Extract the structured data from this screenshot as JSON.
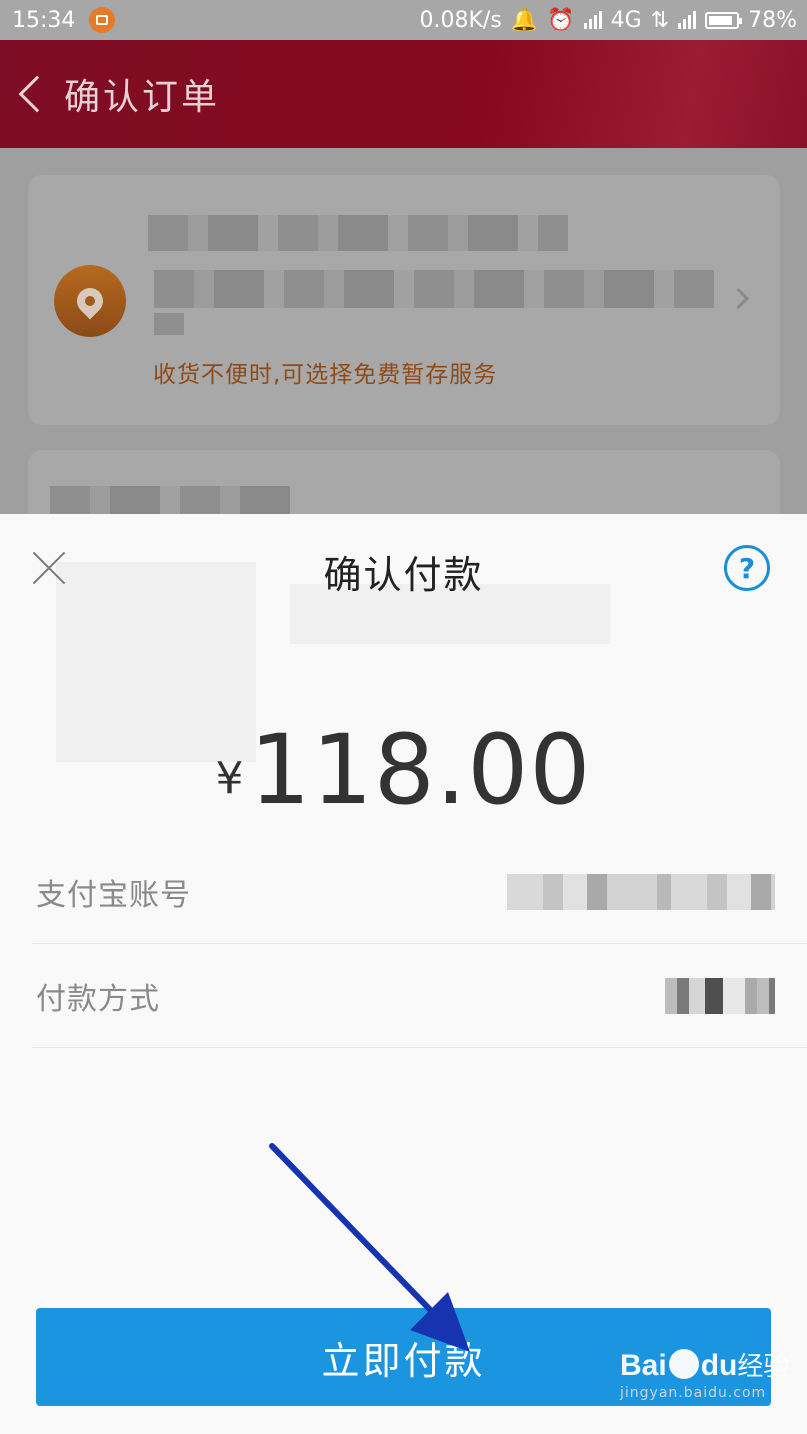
{
  "status_bar": {
    "time": "15:34",
    "network_speed": "0.08K/s",
    "network_type": "4G",
    "battery": "78%",
    "icons": [
      "app-badge-icon",
      "bell-icon",
      "alarm-icon",
      "signal-icon",
      "data-arrows-icon",
      "battery-icon"
    ]
  },
  "header": {
    "title": "确认订单",
    "back_icon": "chevron-left-icon"
  },
  "address_card": {
    "hint": "收货不便时,可选择免费暂存服务",
    "icon": "location-pin-icon",
    "chevron": "chevron-right-icon"
  },
  "payment_sheet": {
    "title": "确认付款",
    "close_icon": "close-icon",
    "help_icon": "question-circle-icon",
    "help_glyph": "?",
    "currency_symbol": "¥",
    "amount": "118.00",
    "rows": [
      {
        "label": "支付宝账号"
      },
      {
        "label": "付款方式"
      }
    ],
    "pay_button_label": "立即付款"
  },
  "watermark": {
    "brand_left": "Bai",
    "brand_right": "du",
    "brand_suffix": "经验",
    "url": "jingyan.baidu.com"
  },
  "colors": {
    "header": "#86091f",
    "accent_blue": "#1b95e0",
    "hint_orange": "#8e4b1a",
    "annotation_arrow": "#1634b0"
  }
}
